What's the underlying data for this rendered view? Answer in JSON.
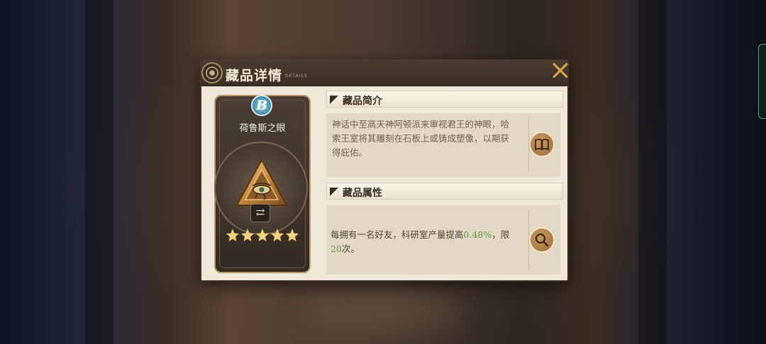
{
  "dialog": {
    "title": "藏品详情",
    "title_sub": "DETAILS"
  },
  "item": {
    "rarity": "B",
    "name": "荷鲁斯之眼",
    "stars": 5
  },
  "intro": {
    "heading": "藏品简介",
    "text": "神话中至高天神阿顿派来审视君王的神眼，哈索王室将其雕刻在石板上或铸成塑像，以期获得庇佑。"
  },
  "attributes": {
    "heading": "藏品属性",
    "text_part1": "每拥有一名好友，科研室产量提高",
    "bonus_value": "0.48%",
    "text_part2": "，限",
    "limit_value": "20",
    "text_part3": "次。"
  },
  "colors": {
    "accent_orange": "#e0a84a",
    "highlight_green": "#5aa03c",
    "rarity_blue": "#3b89aa"
  },
  "icons": [
    "close-icon",
    "swap-icon",
    "book-icon",
    "magnifier-icon",
    "star-icon"
  ]
}
